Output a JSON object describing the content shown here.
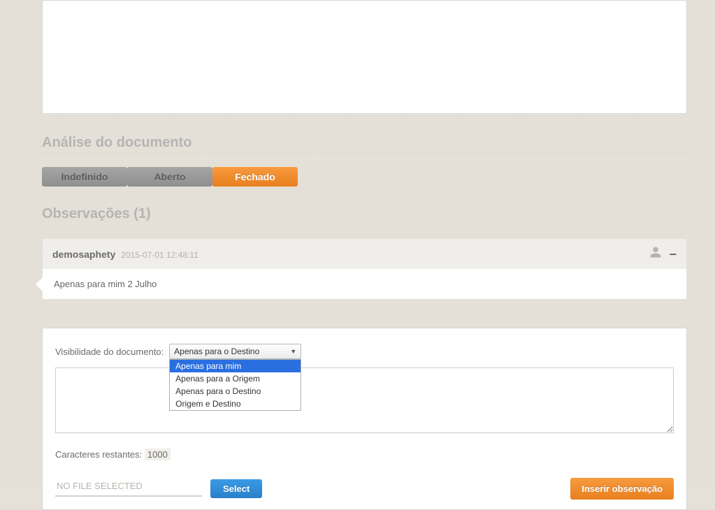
{
  "analysis": {
    "title": "Análise do documento",
    "tabs": [
      {
        "label": "Indefinido",
        "active": false
      },
      {
        "label": "Aberto",
        "active": false
      },
      {
        "label": "Fechado",
        "active": true
      }
    ]
  },
  "observations": {
    "title": "Observações (1)",
    "items": [
      {
        "username": "demosaphety",
        "timestamp": "2015-07-01 12:48:11",
        "body": "Apenas para mim 2 Julho"
      }
    ]
  },
  "form": {
    "visibility_label": "Visibilidade do documento:",
    "visibility_selected": "Apenas para o Destino",
    "visibility_options": [
      "Apenas para mim",
      "Apenas para a Origem",
      "Apenas para o Destino",
      "Origem e Destino"
    ],
    "char_label": "Caracteres restantes: ",
    "char_count": "1000",
    "file_placeholder": "NO FILE SELECTED",
    "select_button": "Select",
    "submit_button": "Inserir observação"
  }
}
